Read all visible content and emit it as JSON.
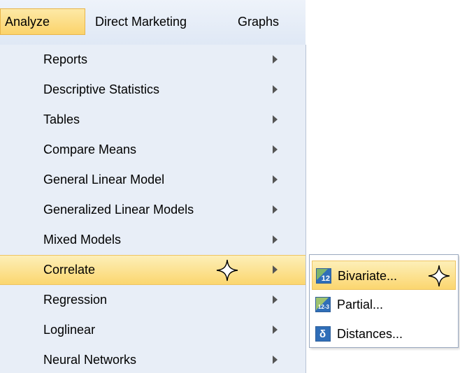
{
  "menubar": {
    "items": [
      {
        "label": "Analyze",
        "active": true
      },
      {
        "label": "Direct Marketing",
        "active": false
      },
      {
        "label": "Graphs",
        "active": false
      }
    ]
  },
  "analyze_menu": {
    "items": [
      {
        "label": "Reports",
        "has_submenu": true
      },
      {
        "label": "Descriptive Statistics",
        "has_submenu": true
      },
      {
        "label": "Tables",
        "has_submenu": true
      },
      {
        "label": "Compare Means",
        "has_submenu": true
      },
      {
        "label": "General Linear Model",
        "has_submenu": true
      },
      {
        "label": "Generalized Linear Models",
        "has_submenu": true
      },
      {
        "label": "Mixed Models",
        "has_submenu": true
      },
      {
        "label": "Correlate",
        "has_submenu": true,
        "highlighted": true
      },
      {
        "label": "Regression",
        "has_submenu": true
      },
      {
        "label": "Loglinear",
        "has_submenu": true
      },
      {
        "label": "Neural Networks",
        "has_submenu": true
      }
    ]
  },
  "correlate_submenu": {
    "items": [
      {
        "label": "Bivariate...",
        "icon": "bivariate-icon",
        "icon_text": "12",
        "highlighted": true
      },
      {
        "label": "Partial...",
        "icon": "partial-icon",
        "icon_text": "12-3"
      },
      {
        "label": "Distances...",
        "icon": "distances-icon",
        "icon_text": "δ"
      }
    ]
  },
  "colors": {
    "highlight": "#fbd66f",
    "menu_background": "#e8eef7",
    "icon_blue": "#2f6eb8"
  }
}
